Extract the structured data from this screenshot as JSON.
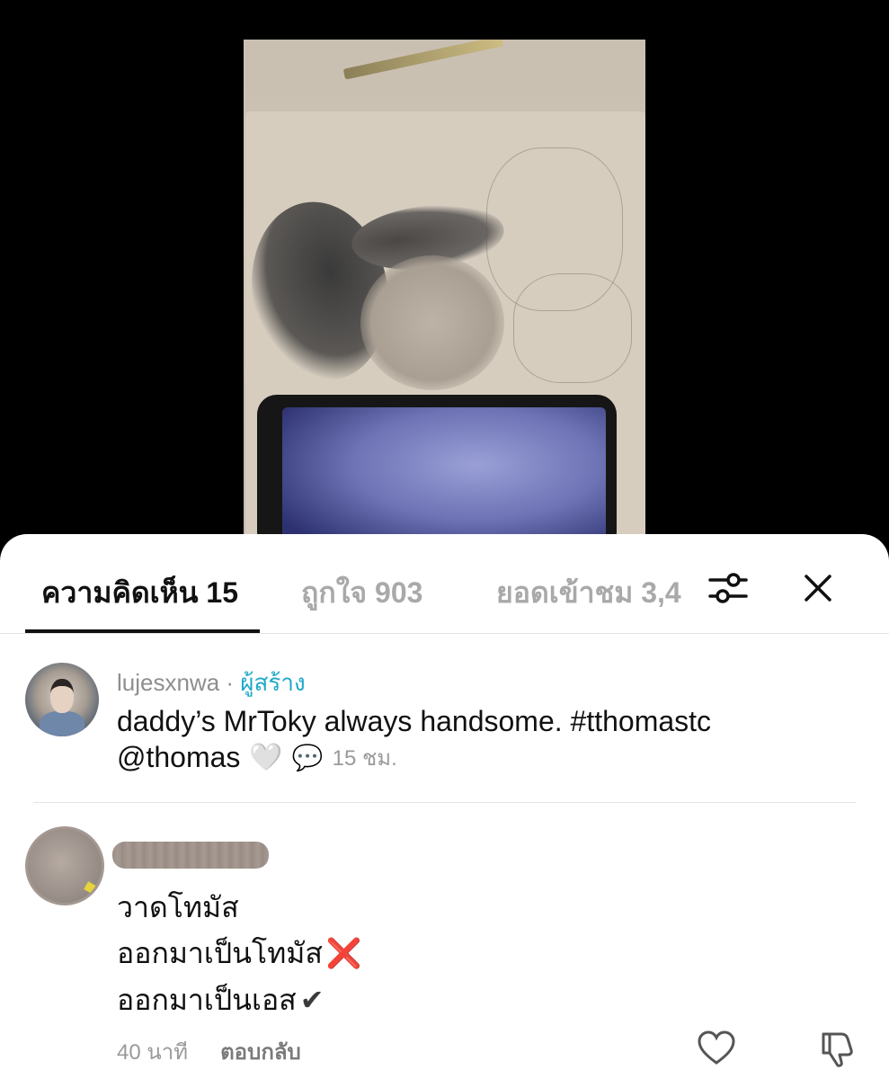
{
  "tabs": {
    "comments": "ความคิดเห็น 15",
    "likes": "ถูกใจ 903",
    "views": "ยอดเข้าชม 3,4"
  },
  "icons": {
    "filter": "sliders-icon",
    "close": "close-icon",
    "heart": "heart-outline-icon",
    "dislike": "thumbs-down-outline-icon"
  },
  "comments": [
    {
      "username": "lujesxnwa",
      "separator": " · ",
      "badge": "ผู้สร้าง",
      "text": "daddy’s MrToky always handsome. #tthomastc",
      "mention": "@thomas",
      "heart_emoji": "🤍",
      "bubble_emoji": "💬",
      "time": "15 ชม."
    },
    {
      "lines": [
        "วาดโทมัส",
        "ออกมาเป็นโทมัส",
        "ออกมาเป็นเอส"
      ],
      "cross_emoji": "❌",
      "check_emoji": "✔",
      "time": "40 นาที",
      "reply": "ตอบกลับ"
    }
  ],
  "colors": {
    "creator_badge": "#1fa9c8",
    "active_tab": "#111111",
    "inactive_tab": "#a9a9a9",
    "meta_text": "#9a9a9a"
  }
}
